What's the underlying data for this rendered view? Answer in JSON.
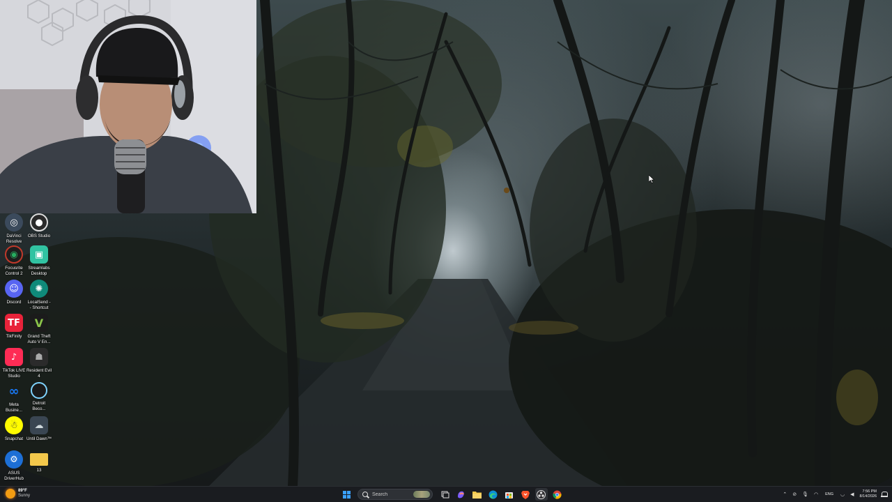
{
  "desktop": {
    "icons": [
      {
        "label": "DaVinci\nResolve",
        "icon": "davinci-resolve-icon",
        "color": "#3b4a5c"
      },
      {
        "label": "OBS Studio",
        "icon": "obs-studio-icon",
        "color": "#2a2a2a"
      },
      {
        "label": "Focusrite\nControl 2",
        "icon": "focusrite-icon",
        "color": "#1e1e1e"
      },
      {
        "label": "Streamlabs\nDesktop",
        "icon": "streamlabs-icon",
        "color": "#31c3a2"
      },
      {
        "label": "Discord",
        "icon": "discord-icon",
        "color": "#5865f2"
      },
      {
        "label": "LocalSend -\n- Shortcut",
        "icon": "localsend-icon",
        "color": "#0f8a7a"
      },
      {
        "label": "TikFinity",
        "icon": "tikfinity-icon",
        "color": "#e8233a"
      },
      {
        "label": "Grand Theft\nAuto V En...",
        "icon": "gta-v-icon",
        "color": "#1b1b1b"
      },
      {
        "label": "TikTok LIVE\nStudio",
        "icon": "tiktok-live-icon",
        "color": "#fe2c55"
      },
      {
        "label": "Resident Evil\n4",
        "icon": "resident-evil-icon",
        "color": "#2b2b2b"
      },
      {
        "label": "Meta\nBusine...",
        "icon": "meta-icon",
        "color": "#0a66ff"
      },
      {
        "label": "Detroit\nBeco...",
        "icon": "detroit-icon",
        "color": "#1a1a1a"
      },
      {
        "label": "Snapchat",
        "icon": "snapchat-icon",
        "color": "#fffc00"
      },
      {
        "label": "Until Dawn™",
        "icon": "until-dawn-icon",
        "color": "#3a4652"
      },
      {
        "label": "ASUS\nDriverHub",
        "icon": "asus-driverhub-icon",
        "color": "#1d6fd6"
      },
      {
        "label": "13",
        "icon": "folder-icon",
        "color": "#f3c84b"
      }
    ]
  },
  "taskbar": {
    "weather": {
      "temp": "89°F",
      "condition": "Sunny"
    },
    "search": {
      "placeholder": "Search"
    },
    "apps": [
      "task-view-icon",
      "copilot-icon",
      "file-explorer-icon",
      "edge-icon",
      "store-icon",
      "brave-icon",
      "obs-taskbar-icon",
      "chrome-icon"
    ],
    "tray": {
      "language": "ENG",
      "time": "7:56 PM",
      "date": "8/14/2026"
    }
  }
}
